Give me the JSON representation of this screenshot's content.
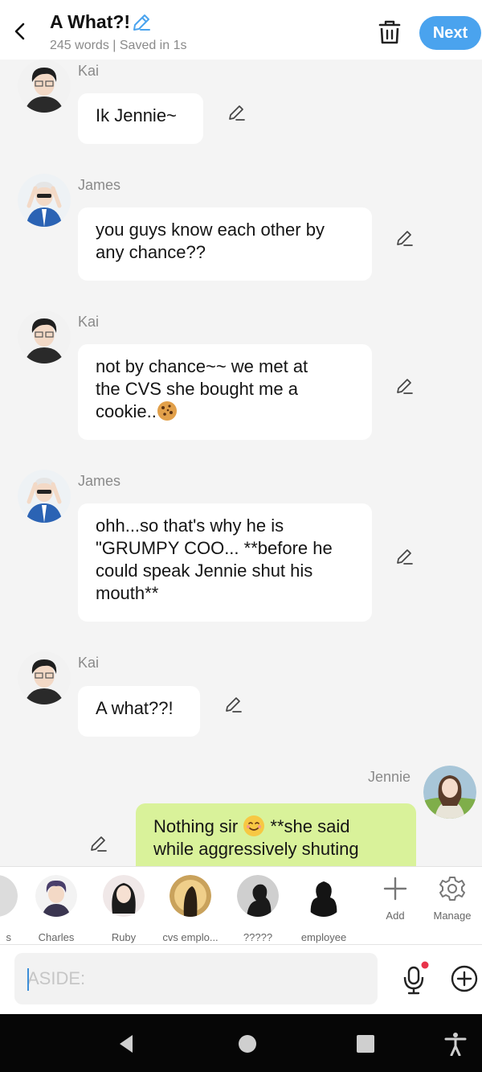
{
  "header": {
    "title": "A What?!",
    "subtitle": "245 words | Saved in 1s",
    "next_label": "Next"
  },
  "messages": [
    {
      "sender": "Kai",
      "lines": [
        "Ik Jennie~"
      ],
      "side": "left"
    },
    {
      "sender": "James",
      "lines": [
        "you guys know each other by",
        "any chance??"
      ],
      "side": "left"
    },
    {
      "sender": "Kai",
      "lines": [
        "not by chance~~ we met at",
        "the CVS she bought me a",
        "cookie.."
      ],
      "side": "left",
      "trailing_icon": "cookie-emoji"
    },
    {
      "sender": "James",
      "lines": [
        "ohh...so that's why he is",
        "\"GRUMPY COO... **before he",
        "could speak Jennie shut his",
        "mouth**"
      ],
      "side": "left"
    },
    {
      "sender": "Kai",
      "lines": [
        "A what??!"
      ],
      "side": "left"
    },
    {
      "sender": "Jennie",
      "lines": [
        "Nothing sir",
        "**she said",
        "while aggressively shuting"
      ],
      "side": "right",
      "inline_icon": "smiling-face-emoji"
    }
  ],
  "characters": [
    {
      "name": "s"
    },
    {
      "name": "Charles"
    },
    {
      "name": "Ruby"
    },
    {
      "name": "cvs emplo..."
    },
    {
      "name": "?????"
    },
    {
      "name": "employee"
    }
  ],
  "tools": {
    "add_label": "Add",
    "manage_label": "Manage"
  },
  "input": {
    "placeholder": "ASIDE:"
  },
  "colors": {
    "accent": "#4aa3ee",
    "player_bubble": "#d9f29a",
    "background": "#f4f4f4"
  }
}
